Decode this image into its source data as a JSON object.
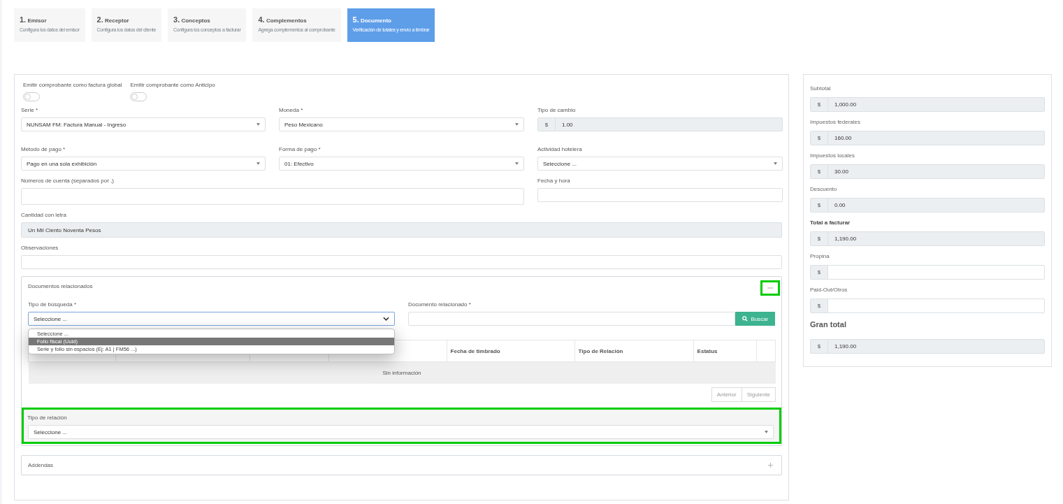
{
  "steps": [
    {
      "number": "1.",
      "title": "Emisor",
      "subtitle": "Configura los datos del emisor",
      "selected": false
    },
    {
      "number": "2.",
      "title": "Receptor",
      "subtitle": "Configura los datos del cliente",
      "selected": false
    },
    {
      "number": "3.",
      "title": "Conceptos",
      "subtitle": "Configura los conceptos a facturar",
      "selected": false
    },
    {
      "number": "4.",
      "title": "Complementos",
      "subtitle": "Agrega complementos al comprobante",
      "selected": false
    },
    {
      "number": "5.",
      "title": "Documento",
      "subtitle": "Verificación de totales y envío a timbrar",
      "selected": true
    }
  ],
  "toggles": [
    {
      "label": "Emitir comprobante como factura global",
      "on": false
    },
    {
      "label": "Emitir comprobante como Anticipo",
      "on": false
    }
  ],
  "serie": {
    "label": "Serie *",
    "value": "NUNSAM FM: Factura Manual - Ingreso"
  },
  "moneda": {
    "label": "Moneda *",
    "value": "Peso Mexicano"
  },
  "tipo_cambio": {
    "label": "Tipo de cambio",
    "prefix": "$",
    "value": "1.00"
  },
  "metodo_pago": {
    "label": "Metodo de pago *",
    "value": "Pago en una sola exhibición"
  },
  "forma_pago": {
    "label": "Forma de pago *",
    "value": "01: Efectivo"
  },
  "actividad_hotelera": {
    "label": "Actividad hotelera",
    "value": "Seleccione ..."
  },
  "numeros_cuenta": {
    "label": "Números de cuenta (separados por ,)"
  },
  "fecha_hora": {
    "label": "Fecha y hora"
  },
  "cantidad_letra": {
    "label": "Cantidad con letra",
    "value": "Un Mil Ciento Noventa Pesos"
  },
  "observaciones": {
    "label": "Observaciones"
  },
  "documentos_relacionados": {
    "title": "Documentos relacionados",
    "expanded": true,
    "collapse_highlighted": true,
    "tipo_busqueda": {
      "label": "Tipo de búsqueda *",
      "value": "Seleccione ...",
      "open": true,
      "options": [
        {
          "label": "Seleccione ...",
          "highlighted": false
        },
        {
          "label": "Folio fiscal (Uuid)",
          "highlighted": true
        },
        {
          "label": "Serie y folio sin espacios (Ej: A1 | FM56 ...)",
          "highlighted": false
        }
      ]
    },
    "documento": {
      "label": "Documento relacionado *"
    },
    "search_button": "Buscar",
    "table": {
      "columns": [
        {
          "covered": true
        },
        {
          "covered": true
        },
        {
          "covered": true
        },
        {
          "covered": true
        },
        {
          "label": "Fecha de timbrado",
          "covered": false
        },
        {
          "label": "Tipo de Relación",
          "covered": false
        },
        {
          "label": "Estatus",
          "covered": false
        }
      ],
      "empty_text": "Sin información"
    },
    "pagination": [
      {
        "label": "Anterior",
        "disabled": true
      },
      {
        "label": "Siguiente",
        "disabled": true
      }
    ],
    "tipo_relacion": {
      "label": "Tipo de relación",
      "value": "Seleccione ...",
      "highlighted": true
    }
  },
  "addendas": {
    "title": "Addendas",
    "expanded": false
  },
  "totals": [
    {
      "label": "Subtotal",
      "prefix": "$",
      "value": "1,000.00",
      "kind": "normal",
      "readonly": true
    },
    {
      "label": "Impuestos federales",
      "prefix": "$",
      "value": "160.00",
      "kind": "normal",
      "readonly": true
    },
    {
      "label": "Impuestos locales",
      "prefix": "$",
      "value": "30.00",
      "kind": "normal",
      "readonly": true
    },
    {
      "label": "Descuento",
      "prefix": "$",
      "value": "0.00",
      "kind": "normal",
      "readonly": true
    },
    {
      "label": "Total a facturar",
      "prefix": "$",
      "value": "1,190.00",
      "kind": "bold",
      "readonly": true
    },
    {
      "label": "Propina",
      "prefix": "$",
      "kind": "normal",
      "readonly": false
    },
    {
      "label": "Paid-Out/Otros",
      "prefix": "$",
      "kind": "normal",
      "readonly": false
    },
    {
      "label": "Gran total",
      "prefix": "$",
      "value": "1,190.00",
      "kind": "heading",
      "readonly": true
    }
  ]
}
